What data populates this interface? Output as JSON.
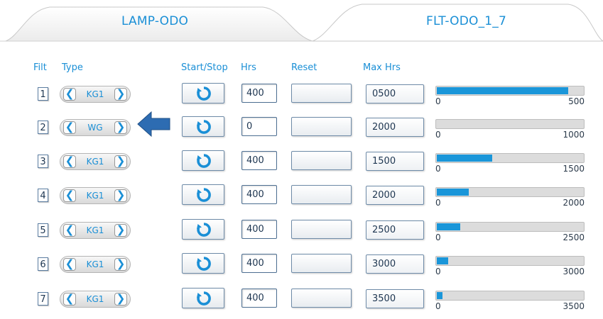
{
  "tabs": [
    {
      "label": "LAMP-ODO",
      "active": false
    },
    {
      "label": "FLT-ODO_1_7",
      "active": true
    }
  ],
  "headers": {
    "filt": "Filt",
    "type": "Type",
    "start_stop": "Start/Stop",
    "hrs": "Hrs",
    "reset": "Reset",
    "max_hrs": "Max Hrs"
  },
  "colors": {
    "accent": "#1a8fd6",
    "bar_fill": "#1a96d9",
    "pointer": "#2d6cb2"
  },
  "rows": [
    {
      "filt": "1",
      "type": "KG1",
      "hrs": "400",
      "max_hrs": "0500",
      "bar_min": "0",
      "bar_max": "500",
      "progress": 0.9
    },
    {
      "filt": "2",
      "type": "WG",
      "hrs": "0",
      "max_hrs": "2000",
      "bar_min": "0",
      "bar_max": "1000",
      "progress": 0
    },
    {
      "filt": "3",
      "type": "KG1",
      "hrs": "400",
      "max_hrs": "1500",
      "bar_min": "0",
      "bar_max": "1500",
      "progress": 0.38
    },
    {
      "filt": "4",
      "type": "KG1",
      "hrs": "400",
      "max_hrs": "2000",
      "bar_min": "0",
      "bar_max": "2000",
      "progress": 0.22
    },
    {
      "filt": "5",
      "type": "KG1",
      "hrs": "400",
      "max_hrs": "2500",
      "bar_min": "0",
      "bar_max": "2500",
      "progress": 0.16
    },
    {
      "filt": "6",
      "type": "KG1",
      "hrs": "400",
      "max_hrs": "3000",
      "bar_min": "0",
      "bar_max": "3000",
      "progress": 0.08
    },
    {
      "filt": "7",
      "type": "KG1",
      "hrs": "400",
      "max_hrs": "3500",
      "bar_min": "0",
      "bar_max": "3500",
      "progress": 0.04
    }
  ]
}
